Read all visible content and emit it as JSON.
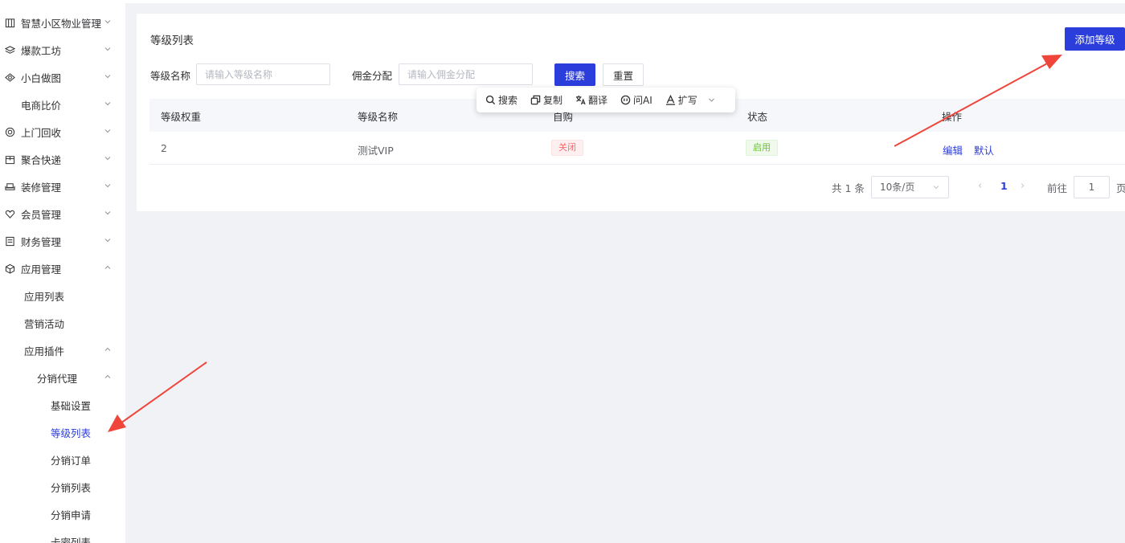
{
  "sidebar": {
    "items": [
      {
        "label": "智慧小区物业管理",
        "icon": "building-icon",
        "chevron": "down"
      },
      {
        "label": "爆款工坊",
        "icon": "layers-icon",
        "chevron": "down"
      },
      {
        "label": "小白做图",
        "icon": "eye-icon",
        "chevron": "down"
      },
      {
        "label": "电商比价",
        "icon": "",
        "chevron": "down"
      },
      {
        "label": "上门回收",
        "icon": "target-icon",
        "chevron": "down"
      },
      {
        "label": "聚合快递",
        "icon": "package-icon",
        "chevron": "down"
      },
      {
        "label": "装修管理",
        "icon": "sofa-icon",
        "chevron": "down"
      },
      {
        "label": "会员管理",
        "icon": "heart-icon",
        "chevron": "down"
      },
      {
        "label": "财务管理",
        "icon": "receipt-icon",
        "chevron": "down"
      },
      {
        "label": "应用管理",
        "icon": "cube-icon",
        "chevron": "up"
      },
      {
        "label": "应用列表"
      },
      {
        "label": "营销活动"
      },
      {
        "label": "应用插件",
        "chevron": "up"
      },
      {
        "label": "分销代理",
        "chevron": "up"
      },
      {
        "label": "基础设置"
      },
      {
        "label": "等级列表",
        "active": true
      },
      {
        "label": "分销订单"
      },
      {
        "label": "分销列表"
      },
      {
        "label": "分销申请"
      },
      {
        "label": "卡密列表"
      }
    ]
  },
  "page": {
    "title": "等级列表",
    "add_button": "添加等级"
  },
  "filters": {
    "level_name_label": "等级名称",
    "level_name_placeholder": "请输入等级名称",
    "commission_label": "佣金分配",
    "commission_placeholder": "请输入佣金分配",
    "search_button": "搜索",
    "reset_button": "重置"
  },
  "table": {
    "columns": [
      "等级权重",
      "等级名称",
      "自购",
      "状态",
      "操作"
    ],
    "rows": [
      {
        "weight": "2",
        "name": "测试VIP",
        "self_purchase": "关闭",
        "status": "启用",
        "actions": [
          "编辑",
          "默认"
        ]
      }
    ]
  },
  "pagination": {
    "total": "共 1 条",
    "page_size": "10条/页",
    "current_page": "1",
    "goto_label": "前往",
    "goto_value": "1",
    "page_suffix": "页"
  },
  "floating_toolbar": {
    "items": [
      {
        "label": "搜索",
        "icon": "search-icon"
      },
      {
        "label": "复制",
        "icon": "copy-icon"
      },
      {
        "label": "翻译",
        "icon": "translate-icon"
      },
      {
        "label": "问AI",
        "icon": "ai-icon"
      },
      {
        "label": "扩写",
        "icon": "expand-write-icon"
      }
    ]
  },
  "colors": {
    "primary": "#2b3ddb",
    "danger_tag": "#f56c6c",
    "success_tag": "#67c23a",
    "annotation_arrow": "#f0453a"
  }
}
